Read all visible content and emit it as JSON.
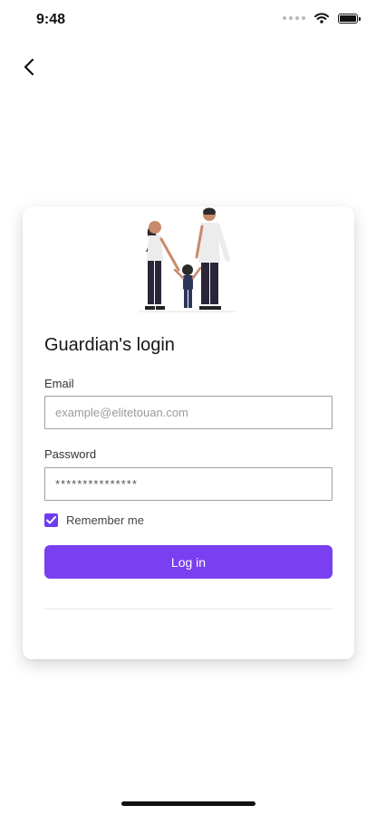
{
  "status_bar": {
    "time": "9:48"
  },
  "login": {
    "title": "Guardian's login",
    "email_label": "Email",
    "email_placeholder": "example@elitetouan.com",
    "email_value": "",
    "password_label": "Password",
    "password_value": "***************",
    "remember_label": "Remember me",
    "remember_checked": true,
    "login_button": "Log in"
  },
  "colors": {
    "accent": "#7a3ff0",
    "checkbox": "#6e3df0",
    "text": "#1f1f1f",
    "field_border": "#9e9e9e"
  },
  "icons": [
    "back-chevron-icon",
    "wifi-icon",
    "battery-icon",
    "checkmark-icon",
    "family-illustration"
  ]
}
